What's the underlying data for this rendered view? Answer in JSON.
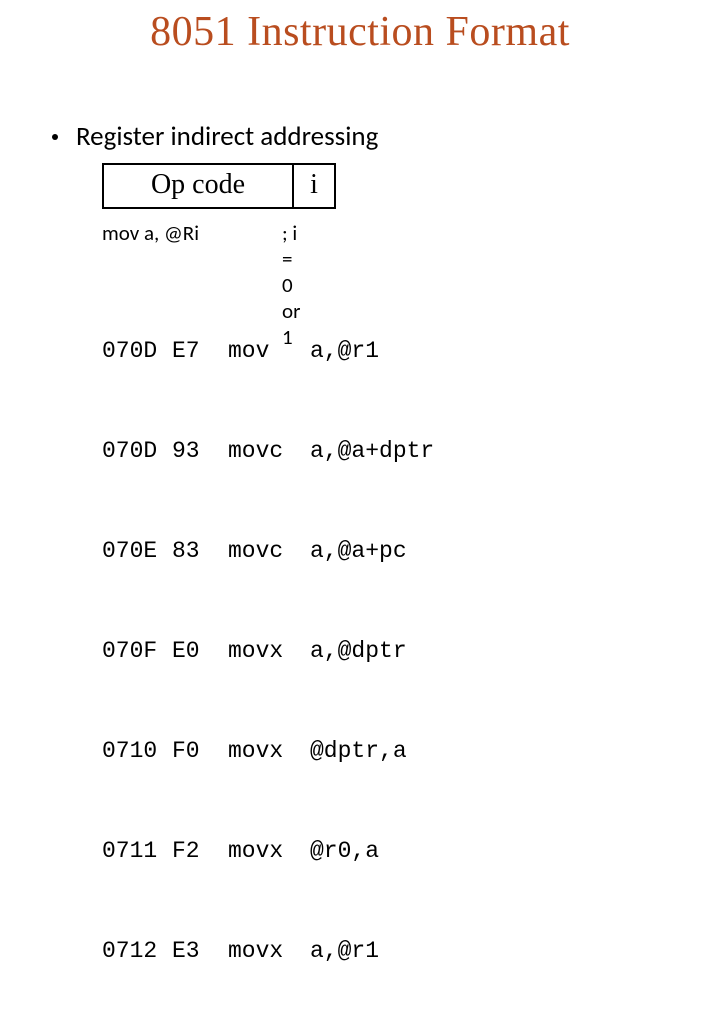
{
  "title": "8051 Instruction Format",
  "bullet": "Register indirect addressing",
  "format": {
    "opcode_label": "Op code",
    "i_label": "i"
  },
  "example": {
    "mnemonic": "mov a, @Ri",
    "comment": "; i = 0 or 1"
  },
  "code": [
    {
      "addr": "070D",
      "hex": "E7",
      "mn": "mov",
      "ops": "a,@r1"
    },
    {
      "addr": "070D",
      "hex": "93",
      "mn": "movc",
      "ops": "a,@a+dptr"
    },
    {
      "addr": "070E",
      "hex": "83",
      "mn": "movc",
      "ops": "a,@a+pc"
    },
    {
      "addr": "070F",
      "hex": "E0",
      "mn": "movx",
      "ops": "a,@dptr"
    },
    {
      "addr": "0710",
      "hex": "F0",
      "mn": "movx",
      "ops": "@dptr,a"
    },
    {
      "addr": "0711",
      "hex": "F2",
      "mn": "movx",
      "ops": "@r0,a"
    },
    {
      "addr": "0712",
      "hex": "E3",
      "mn": "movx",
      "ops": "a,@r1"
    }
  ]
}
